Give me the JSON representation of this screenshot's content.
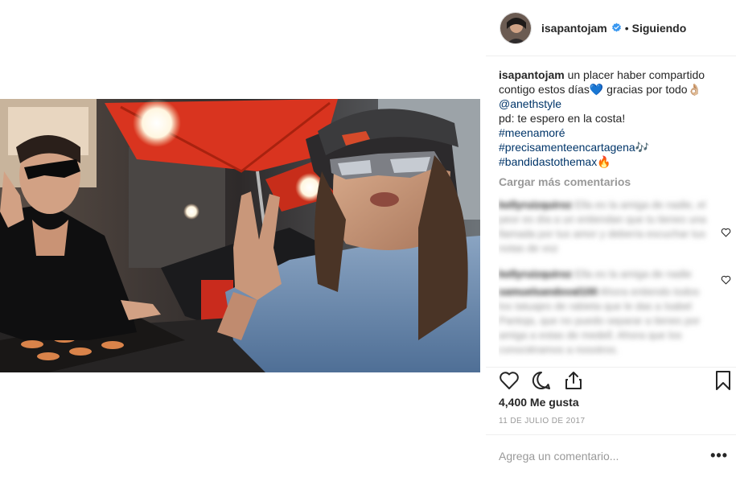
{
  "post": {
    "username": "isapantojam",
    "follow_status": "Siguiendo",
    "separator": "•",
    "verified_icon": "verified-badge-icon"
  },
  "caption": {
    "username": "isapantojam",
    "line1": "un placer haber compartido",
    "line2": "contigo estos días💙 gracias por todo👌🏼",
    "mention": "@anethstyle",
    "line3": "pd: te espero en la costa!",
    "hashtag1": "#meenamoré",
    "hashtag2": "#precisamenteencartagena🎶",
    "hashtag3": "#bandidastothemax🔥"
  },
  "load_more_label": "Cargar más comentarios",
  "blurred_comments": [
    {
      "user": "kellyruizquiroz",
      "text": "Ella es la amiga de nadie, el peor es día a un entiendan que tu tienes una llamada por tus amor y debería escuchar tus notas de voz"
    },
    {
      "user": "kellyruizquiroz",
      "text": "Ella es la amiga de nadie"
    },
    {
      "user": "samuelsandoval100",
      "text": "Ahora entiendo todos los tatuajes de rabieta que le das a Isabel Pantoja, que no puedo separar a tienes por amiga a estas de medell. Ahora que los conociéramos a nosotros."
    }
  ],
  "likes_label": "4,400 Me gusta",
  "date_label": "11 DE JULIO DE 2017",
  "comment_placeholder": "Agrega un comentario...",
  "more_options": "•••",
  "colors": {
    "text": "#262626",
    "muted": "#999999",
    "link": "#003569",
    "border": "#efefef",
    "verified": "#3897f0"
  }
}
